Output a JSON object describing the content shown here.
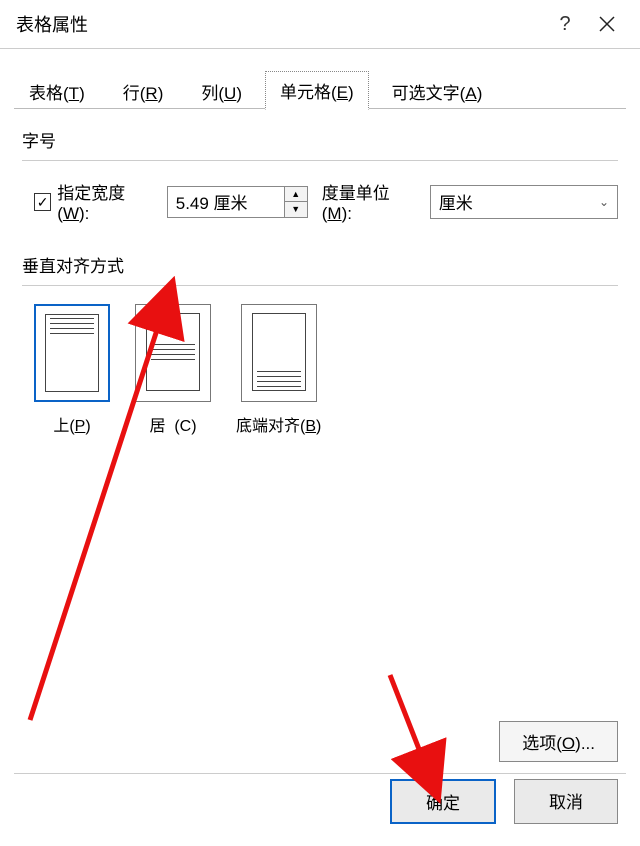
{
  "title": "表格属性",
  "tabs": {
    "table": "表格(T)",
    "row": "行(R)",
    "column": "列(U)",
    "cell": "单元格(E)",
    "alt": "可选文字(A)"
  },
  "section_size": "字号",
  "specify_width_label_pre": "指定宽度(",
  "specify_width_label_key": "W",
  "specify_width_label_post": "):",
  "width_value": "5.49 厘米",
  "measure_label_pre": "度量单位(",
  "measure_label_key": "M",
  "measure_label_post": "):",
  "unit_value": "厘米",
  "section_valign": "垂直对齐方式",
  "align": {
    "top": "上(P)",
    "center_pre": "居",
    "center_key": "(C)",
    "bottom": "底端对齐(B)"
  },
  "options_btn": "选项(O)...",
  "ok": "确定",
  "cancel": "取消"
}
